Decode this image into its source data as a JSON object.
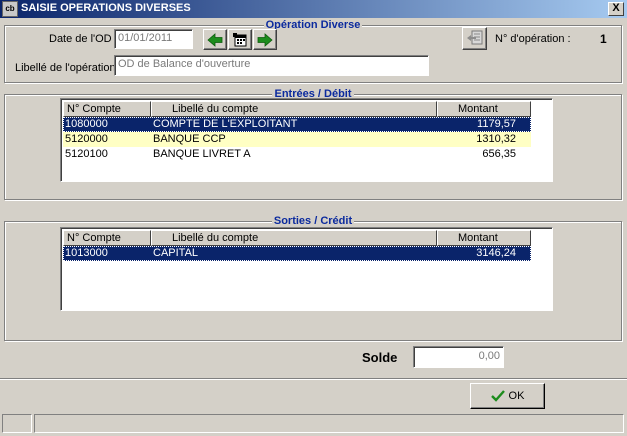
{
  "window": {
    "title": "SAISIE OPERATIONS DIVERSES",
    "close_glyph": "X",
    "icon_text": "cb"
  },
  "operation": {
    "group_title": "Opération Diverse",
    "date_label": "Date de l'OD",
    "date_value": "01/01/2011",
    "libelle_label": "Libellé de l'opération",
    "libelle_value": "OD de Balance d'ouverture",
    "numero_label": "N° d'opération :",
    "numero_value": "1"
  },
  "entrees": {
    "group_title": "Entrées / Débit",
    "columns": [
      "N° Compte",
      "Libellé du compte",
      "Montant"
    ],
    "rows": [
      {
        "compte": "1080000",
        "libelle": "COMPTE DE L'EXPLOITANT",
        "montant": "1179,57"
      },
      {
        "compte": "5120000",
        "libelle": "BANQUE CCP",
        "montant": "1310,32"
      },
      {
        "compte": "5120100",
        "libelle": "BANQUE LIVRET A",
        "montant": "656,35"
      }
    ]
  },
  "sorties": {
    "group_title": "Sorties / Crédit",
    "columns": [
      "N° Compte",
      "Libellé du compte",
      "Montant"
    ],
    "rows": [
      {
        "compte": "1013000",
        "libelle": "CAPITAL",
        "montant": "3146,24"
      }
    ]
  },
  "solde": {
    "label": "Solde",
    "value": "0,00"
  },
  "ok_button": {
    "label": "OK"
  },
  "icons": [
    "arrow-left-icon",
    "calendar-icon",
    "arrow-right-icon",
    "document-arrow-icon",
    "check-icon",
    "close-icon"
  ],
  "colors": {
    "selected_row": "#0a246a",
    "highlight_row": "#ffffc4",
    "group_title": "#0b2a9e",
    "arrow_green": "#1c8c1c"
  }
}
